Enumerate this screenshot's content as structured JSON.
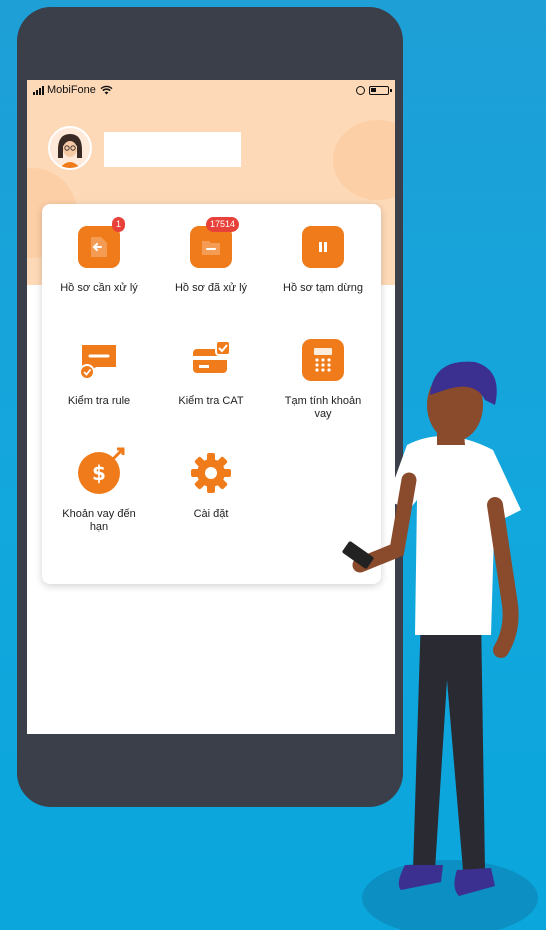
{
  "status_bar": {
    "carrier": "MobiFone"
  },
  "profile": {
    "avatar_icon": "user-avatar-icon",
    "name": ""
  },
  "menu": [
    {
      "label": "Hồ sơ cần xử lý",
      "icon": "return-document-icon",
      "badge": "1"
    },
    {
      "label": "Hồ sơ đã xử lý",
      "icon": "processed-folder-icon",
      "badge": "17514"
    },
    {
      "label": "Hồ sơ tạm dừng",
      "icon": "pause-document-icon",
      "badge": ""
    },
    {
      "label": "Kiểm tra rule",
      "icon": "check-rule-icon",
      "badge": ""
    },
    {
      "label": "Kiểm tra CAT",
      "icon": "check-card-icon",
      "badge": ""
    },
    {
      "label": "Tạm tính khoản vay",
      "icon": "calculator-icon",
      "badge": ""
    },
    {
      "label": "Khoản vay đến hạn",
      "icon": "dollar-due-icon",
      "badge": ""
    },
    {
      "label": "Cài đặt",
      "icon": "gear-icon",
      "badge": ""
    }
  ],
  "colors": {
    "accent": "#f07b1a",
    "badge": "#e8413a",
    "header_bg": "#fdd9b7",
    "phone_frame": "#3b3f4a",
    "background": "#12a7dd"
  }
}
